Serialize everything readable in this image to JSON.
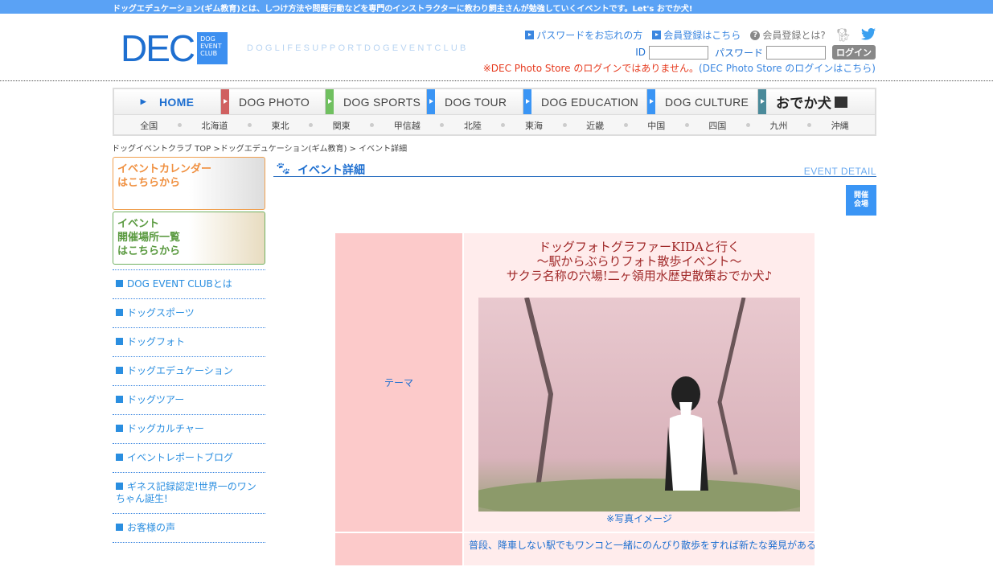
{
  "topbar": {
    "text": "ドッグエデュケーション(ギム教育)とは、しつけ方法や問題行動などを専門のインストラクターに教わり飼主さんが勉強していくイベントです。Let's おでか犬!"
  },
  "logo": {
    "main": "DEC",
    "box": [
      "DOG",
      "EVENT",
      "CLUB"
    ],
    "tagline": "DOGLIFESUPPORTDOGEVENTCLUB"
  },
  "header": {
    "forgot_password": "パスワードをお忘れの方",
    "register": "会員登録はこちら",
    "about_member": "会員登録とは?",
    "id_label": "ID",
    "password_label": "パスワード",
    "login_button": "ログイン",
    "notice_red": "※DEC Photo Store のログインではありません。",
    "notice_link": "(DEC Photo Store のログインはこちら)"
  },
  "nav": {
    "items": [
      {
        "label": "HOME",
        "color": "#1e6fd0"
      },
      {
        "label": "DOG PHOTO",
        "color": "#d06060"
      },
      {
        "label": "DOG SPORTS",
        "color": "#70c060"
      },
      {
        "label": "DOG TOUR",
        "color": "#3a95f5"
      },
      {
        "label": "DOG EDUCATION",
        "color": "#3a95f5"
      },
      {
        "label": "DOG CULTURE",
        "color": "#3a95f5"
      },
      {
        "label": "おでか犬",
        "color": "#4a8a9a"
      }
    ],
    "regions": [
      "全国",
      "北海道",
      "東北",
      "関東",
      "甲信越",
      "北陸",
      "東海",
      "近畿",
      "中国",
      "四国",
      "九州",
      "沖縄"
    ]
  },
  "breadcrumb": "ドッグイベントクラブ TOP >ドッグエデュケーション(ギム教育) > イベント詳細",
  "banners": {
    "calendar": [
      "イベントカレンダー",
      "はこちらから"
    ],
    "venues": [
      "イベント",
      "開催場所一覧",
      "はこちらから"
    ]
  },
  "sidebar": {
    "items": [
      "DOG EVENT CLUBとは",
      "ドッグスポーツ",
      "ドッグフォト",
      "ドッグエデュケーション",
      "ドッグツアー",
      "ドッグカルチャー",
      "イベントレポートブログ",
      "ギネス記録認定!世界一のワンちゃん誕生!",
      "お客様の声"
    ]
  },
  "main": {
    "heading": "イベント詳細",
    "heading_en": "EVENT DETAIL",
    "venue_button": [
      "開催",
      "会場"
    ],
    "rows": [
      {
        "label": "テーマ",
        "title": [
          "ドッグフォトグラファーKIDAと行く",
          "〜駅からぶらりフォト散歩イベント〜",
          "サクラ名称の穴場!二ヶ領用水歴史散策おでか犬♪"
        ],
        "caption": "※写真イメージ"
      },
      {
        "label": "",
        "text": "普段、降車しない駅でもワンコと一緒にのんびり散歩をすれば新たな発見があるかも"
      }
    ]
  }
}
